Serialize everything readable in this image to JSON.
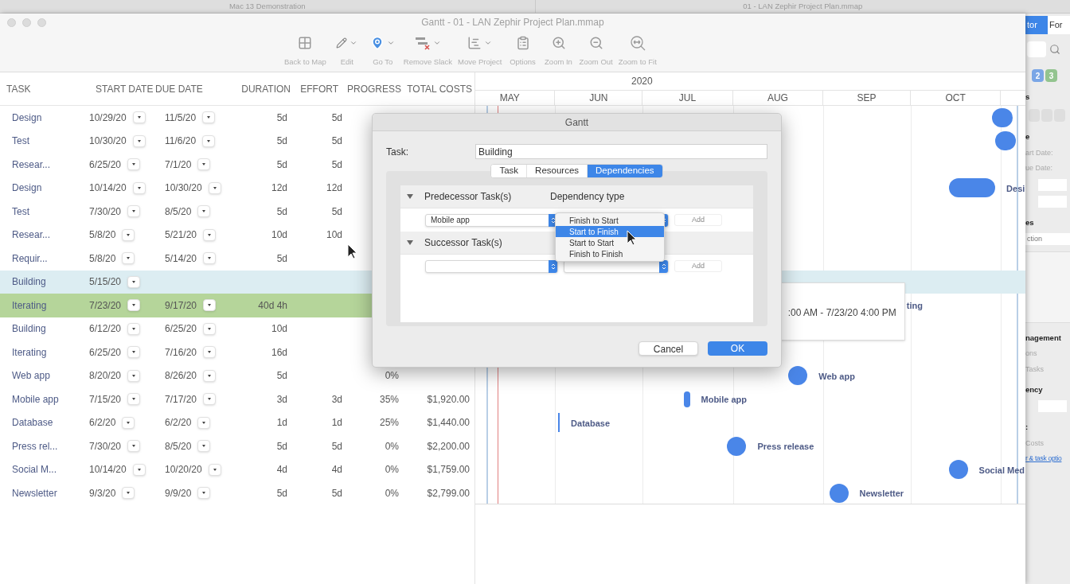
{
  "screen_tabs": [
    {
      "title": "Mac 13 Demonstration"
    },
    {
      "title": "01 - LAN Zephir Project Plan.mmap"
    }
  ],
  "window": {
    "title": "Gantt - 01 - LAN Zephir Project Plan.mmap"
  },
  "toolbar": [
    {
      "label": "Back to Map",
      "dropdown": false
    },
    {
      "label": "Edit",
      "dropdown": true
    },
    {
      "label": "Go To",
      "dropdown": true
    },
    {
      "label": "Remove Slack",
      "dropdown": true
    },
    {
      "label": "Move Project",
      "dropdown": true
    },
    {
      "label": "Options",
      "dropdown": false
    },
    {
      "label": "Zoom In",
      "dropdown": false
    },
    {
      "label": "Zoom Out",
      "dropdown": false
    },
    {
      "label": "Zoom to Fit",
      "dropdown": false
    }
  ],
  "table": {
    "columns": [
      "TASK",
      "START DATE",
      "DUE DATE",
      "DURATION",
      "EFFORT",
      "PROGRESS",
      "TOTAL COSTS"
    ],
    "rows": [
      {
        "task": "Design",
        "start": "10/29/20",
        "due": "11/5/20",
        "duration": "5d",
        "effort": "5d",
        "selected": false,
        "highlighted": false,
        "bar": true
      },
      {
        "task": "Test",
        "start": "10/30/20",
        "due": "11/6/20",
        "duration": "5d",
        "effort": "5d",
        "selected": false,
        "highlighted": false,
        "bar": true
      },
      {
        "task": "Resear...",
        "start": "6/25/20",
        "due": "7/1/20",
        "duration": "5d",
        "effort": "5d",
        "selected": false,
        "highlighted": false
      },
      {
        "task": "Design",
        "start": "10/14/20",
        "due": "10/30/20",
        "duration": "12d",
        "effort": "12d",
        "selected": false,
        "highlighted": false,
        "bar": true,
        "bar_label": "Desi"
      },
      {
        "task": "Test",
        "start": "7/30/20",
        "due": "8/5/20",
        "duration": "5d",
        "effort": "5d",
        "selected": false,
        "highlighted": false
      },
      {
        "task": "Resear...",
        "start": "5/8/20",
        "due": "5/21/20",
        "duration": "10d",
        "effort": "10d",
        "selected": false,
        "highlighted": false
      },
      {
        "task": "Requir...",
        "start": "5/8/20",
        "due": "5/14/20",
        "duration": "5d",
        "selected": false,
        "highlighted": false
      },
      {
        "task": "Building",
        "start": "5/15/20",
        "selected": true,
        "highlighted": false
      },
      {
        "task": "Iterating",
        "start": "7/23/20",
        "due": "9/17/20",
        "duration": "40d 4h",
        "selected": false,
        "highlighted": true,
        "bar_label": "ting",
        "tooltip": ":00 AM - 7/23/20 4:00 PM"
      },
      {
        "task": "Building",
        "start": "6/12/20",
        "due": "6/25/20",
        "duration": "10d",
        "selected": false,
        "highlighted": false
      },
      {
        "task": "Iterating",
        "start": "6/25/20",
        "due": "7/16/20",
        "duration": "16d",
        "selected": false,
        "highlighted": false
      },
      {
        "task": "Web app",
        "start": "8/20/20",
        "due": "8/26/20",
        "duration": "5d",
        "progress": "0%",
        "selected": false,
        "highlighted": false,
        "bar": true,
        "bar_label": "Web app"
      },
      {
        "task": "Mobile app",
        "start": "7/15/20",
        "due": "7/17/20",
        "duration": "3d",
        "effort": "3d",
        "progress": "35%",
        "total_costs": "$1,920.00",
        "selected": false,
        "highlighted": false,
        "bar": true,
        "bar_label": "Mobile app"
      },
      {
        "task": "Database",
        "start": "6/2/20",
        "due": "6/2/20",
        "duration": "1d",
        "effort": "1d",
        "progress": "25%",
        "total_costs": "$1,440.00",
        "selected": false,
        "highlighted": false,
        "bar": true,
        "bar_label": "Database"
      },
      {
        "task": "Press rel...",
        "start": "7/30/20",
        "due": "8/5/20",
        "duration": "5d",
        "effort": "5d",
        "progress": "0%",
        "total_costs": "$2,200.00",
        "selected": false,
        "highlighted": false,
        "bar": true,
        "bar_label": "Press release"
      },
      {
        "task": "Social M...",
        "start": "10/14/20",
        "due": "10/20/20",
        "duration": "4d",
        "effort": "4d",
        "progress": "0%",
        "total_costs": "$1,759.00",
        "selected": false,
        "highlighted": false,
        "bar": true,
        "bar_label": "Social Med"
      },
      {
        "task": "Newsletter",
        "start": "9/3/20",
        "due": "9/9/20",
        "duration": "5d",
        "effort": "5d",
        "progress": "0%",
        "total_costs": "$2,799.00",
        "selected": false,
        "highlighted": false,
        "bar": true,
        "bar_label": "Newsletter"
      }
    ]
  },
  "gantt": {
    "year": "2020",
    "months": [
      "MAY",
      "JUN",
      "JUL",
      "AUG",
      "SEP",
      "OCT"
    ]
  },
  "dialog": {
    "title": "Gantt",
    "task_label": "Task:",
    "task_value": "Building",
    "tabs": [
      {
        "label": "Task",
        "selected": false
      },
      {
        "label": "Resources",
        "selected": false
      },
      {
        "label": "Dependencies",
        "selected": true
      }
    ],
    "sections": [
      {
        "heading": "Predecessor Task(s)",
        "column": "Dependency type",
        "expanded": true,
        "task": "Mobile app",
        "add": "Add",
        "add_disabled": true
      },
      {
        "heading": "Successor Task(s)",
        "expanded": true,
        "add": "Add",
        "add_disabled": true
      }
    ],
    "menu": [
      {
        "label": "Finish to Start",
        "selected": false
      },
      {
        "label": "Start to Finish",
        "selected": true
      },
      {
        "label": "Start to Start",
        "selected": false
      },
      {
        "label": "Finish to Finish",
        "selected": false
      }
    ],
    "buttons": [
      {
        "label": "Cancel",
        "primary": false
      },
      {
        "label": "OK",
        "primary": true
      }
    ]
  },
  "inspector": {
    "tabs": [
      {
        "label": "tor",
        "selected": true
      },
      {
        "label": "For",
        "selected": false
      }
    ],
    "badges": [
      {
        "label": "2",
        "color": "#7aa6e6"
      },
      {
        "label": "3",
        "color": "#93c48f"
      }
    ],
    "lines": [
      {
        "kind": "heading",
        "text": "s"
      },
      {
        "kind": "icons"
      },
      {
        "kind": "heading",
        "text": "e"
      },
      {
        "kind": "label",
        "text": "art Date:"
      },
      {
        "kind": "label",
        "text": "ue Date:"
      },
      {
        "kind": "field"
      },
      {
        "kind": "field"
      },
      {
        "kind": "heading",
        "text": "es"
      },
      {
        "kind": "search",
        "text": "ction"
      },
      {
        "kind": "block"
      },
      {
        "kind": "heading",
        "text": "nagement"
      },
      {
        "kind": "label",
        "text": "ons"
      },
      {
        "kind": "label",
        "text": "Tasks"
      },
      {
        "kind": "heading",
        "text": "ency"
      },
      {
        "kind": "field"
      },
      {
        "kind": "heading",
        "text": ":"
      },
      {
        "kind": "label",
        "text": "Costs"
      },
      {
        "kind": "link",
        "text": "r & task optio"
      }
    ]
  }
}
